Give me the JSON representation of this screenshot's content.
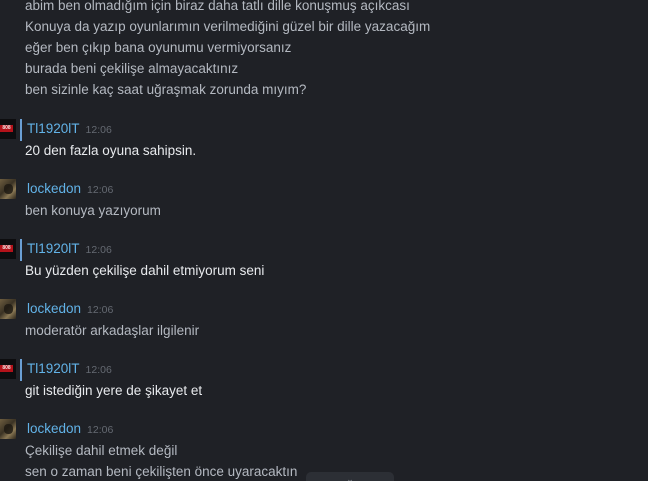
{
  "messages_top": [
    "abim ben olmadığım için biraz daha tatlı dille konuşmuş açıkcası",
    "Konuya da yazıp oyunlarımın verilmediğini güzel bir dille yazacağım",
    "eğer ben çıkıp bana oyunumu vermiyorsanız",
    "burada beni çekilişe almayacaktınız",
    "ben sizinle kaç saat uğraşmak zorunda mıyım?"
  ],
  "groups": [
    {
      "sender": "Tl1920lT",
      "time": "12:06",
      "avatar": "red-logo-avatar",
      "avatar_tag": "808",
      "lines": [
        "20 den fazla oyuna sahipsin."
      ]
    },
    {
      "sender": "lockedon",
      "time": "12:06",
      "avatar": "photo-avatar",
      "lines": [
        "ben konuya yazıyorum"
      ]
    },
    {
      "sender": "Tl1920lT",
      "time": "12:06",
      "avatar": "red-logo-avatar",
      "avatar_tag": "808",
      "lines": [
        "Bu yüzden çekilişe dahil etmiyorum seni"
      ]
    },
    {
      "sender": "lockedon",
      "time": "12:06",
      "avatar": "photo-avatar",
      "lines": [
        "moderatör arkadaşlar ilgilenir"
      ]
    },
    {
      "sender": "Tl1920lT",
      "time": "12:06",
      "avatar": "red-logo-avatar",
      "avatar_tag": "808",
      "lines": [
        "git istediğin yere de şikayet et"
      ]
    },
    {
      "sender": "lockedon",
      "time": "12:06",
      "avatar": "photo-avatar",
      "lines": [
        "Çekilişe dahil etmek değil",
        "sen o zaman beni çekilişten önce uyaracaktın"
      ]
    }
  ],
  "colors": {
    "background": "#1f2126",
    "sender_name": "#62b3e8",
    "message_from_other": "#e8eaed",
    "message_from_self": "#b4b9c1",
    "timestamp": "#656a72",
    "marker": "#6b9fd4",
    "avatar_red": "#b3121a"
  }
}
